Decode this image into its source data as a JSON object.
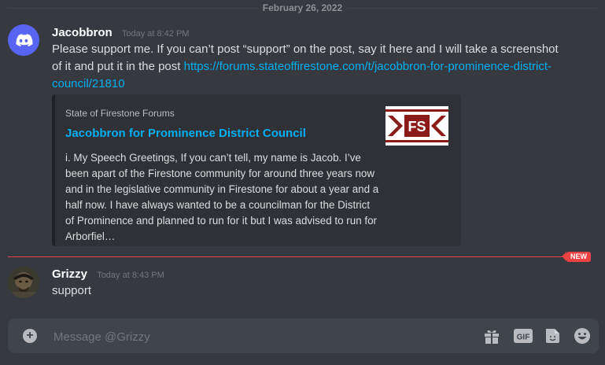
{
  "divider": {
    "date": "February 26, 2022"
  },
  "messages": [
    {
      "author": "Jacobbron",
      "timestamp": "Today at 8:42 PM",
      "text": "Please support me. If you can’t post “support” on the post, say it here and I will take a screenshot of it and put it in the post ",
      "link": "https://forums.stateoffirestone.com/t/jacobbron-for-prominence-district-council/21810",
      "embed": {
        "provider": "State of Firestone Forums",
        "title": "Jacobbron for Prominence District Council",
        "description": "i. My Speech Greetings, If you can’t tell, my name is Jacob. I’ve been apart of the Firestone community for around three years now and in the legislative community in Firestone for about a year and a half now. I have always wanted to be a councilman for the District of Prominence and planned to run for it but I was advised to run for Arborfiel…",
        "thumbnail_text": "FS"
      }
    },
    {
      "author": "Grizzy",
      "timestamp": "Today at 8:43 PM",
      "text": "support"
    }
  ],
  "new_badge": "NEW",
  "composer": {
    "placeholder": "Message @Grizzy",
    "gif_label": "GIF"
  },
  "colors": {
    "background": "#36393f",
    "link": "#00aff4",
    "new_marker": "#ed4245",
    "discord_blurple": "#5865f2"
  }
}
